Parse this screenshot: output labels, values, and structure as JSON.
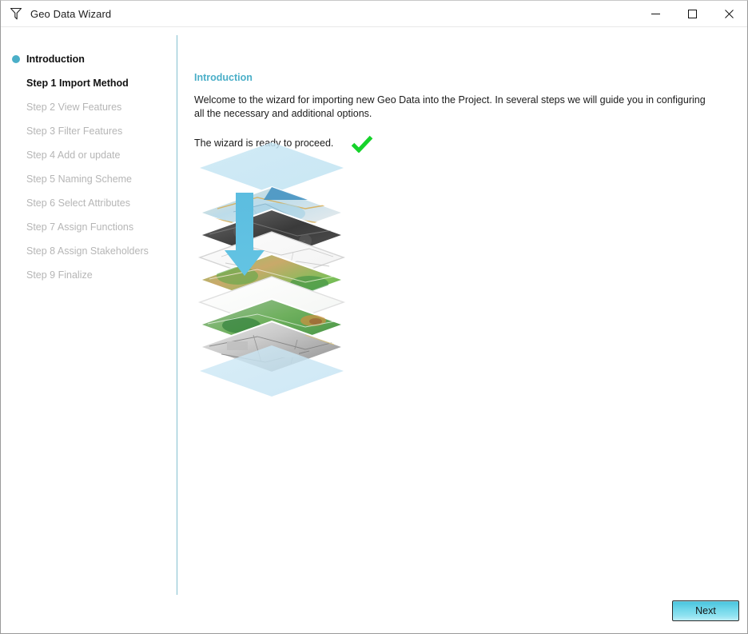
{
  "window": {
    "title": "Geo Data Wizard",
    "icon": "funnel-icon",
    "controls": {
      "minimize": "Minimize",
      "maximize": "Maximize",
      "close": "Close"
    }
  },
  "sidebar": {
    "items": [
      {
        "label": "Introduction",
        "state": "active",
        "bullet": true
      },
      {
        "label": "Step 1 Import Method",
        "state": "current",
        "bullet": false
      },
      {
        "label": "Step 2 View Features",
        "state": "disabled",
        "bullet": false
      },
      {
        "label": "Step 3 Filter Features",
        "state": "disabled",
        "bullet": false
      },
      {
        "label": "Step 4 Add or update",
        "state": "disabled",
        "bullet": false
      },
      {
        "label": "Step 5 Naming Scheme",
        "state": "disabled",
        "bullet": false
      },
      {
        "label": "Step 6 Select Attributes",
        "state": "disabled",
        "bullet": false
      },
      {
        "label": "Step 7 Assign Functions",
        "state": "disabled",
        "bullet": false
      },
      {
        "label": "Step 8 Assign Stakeholders",
        "state": "disabled",
        "bullet": false
      },
      {
        "label": "Step 9 Finalize",
        "state": "disabled",
        "bullet": false
      }
    ]
  },
  "main": {
    "heading": "Introduction",
    "paragraph": "Welcome to the wizard for importing new Geo Data into the Project. In several steps we will guide you in configuring all the necessary and additional options.",
    "ready_text": "The wizard is ready to proceed.",
    "ready_status_icon": "green-checkmark-icon",
    "illustration_name": "stacked-map-layers-illustration"
  },
  "footer": {
    "next_label": "Next"
  },
  "colors": {
    "accent": "#4bafc8",
    "heading": "#4bafc8",
    "bullet": "#4bafc8",
    "divider": "#84c0d0",
    "disabled_text": "#b6b6b6",
    "body_text": "#1b1b1b",
    "check_green": "#16d32b",
    "button_gradient_top": "#46c3dd",
    "button_gradient_bottom": "#bdeef6",
    "button_border": "#2c2c2c"
  }
}
